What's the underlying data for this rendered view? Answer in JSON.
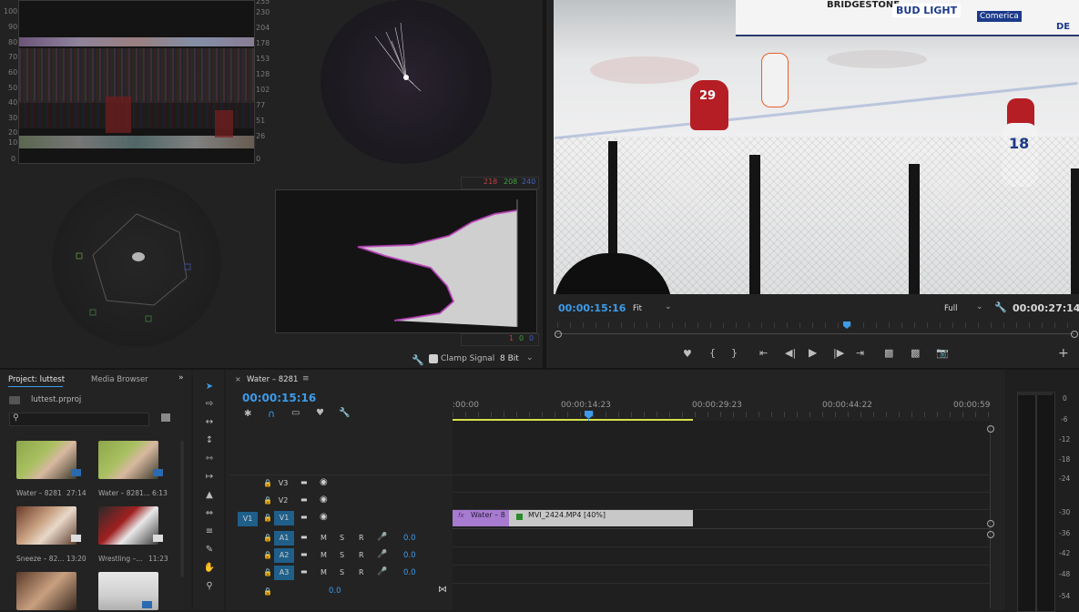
{
  "scopes": {
    "waveform_left_ticks": [
      "100",
      "90",
      "80",
      "70",
      "60",
      "50",
      "40",
      "30",
      "20",
      "10",
      "0"
    ],
    "waveform_right_ticks": [
      "255",
      "230",
      "204",
      "178",
      "153",
      "128",
      "102",
      "77",
      "51",
      "26",
      "0"
    ],
    "parade_top_values": [
      "218",
      "208",
      "240"
    ],
    "parade_bottom_values": [
      "1",
      "0",
      "0"
    ],
    "clamp_signal_label": "Clamp Signal",
    "bit_depth": "8 Bit"
  },
  "program_monitor": {
    "current_time": "00:00:15:16",
    "fit_label": "Fit",
    "quality_label": "Full",
    "duration": "00:00:27:14",
    "video_text": {
      "banner1": "BRIDGESTONE",
      "banner2": "BUD LIGHT",
      "banner3": "Comerica",
      "banner4": "DE",
      "jersey1": "29",
      "jersey2": "18"
    }
  },
  "project_panel": {
    "tab_project": "Project: luttest",
    "tab_media": "Media Browser",
    "file_name": "luttest.prproj",
    "items": [
      {
        "name": "Water – 8281",
        "duration": "27:14"
      },
      {
        "name": "Water – 8281...",
        "duration": "6:13"
      },
      {
        "name": "Sneeze – 82...",
        "duration": "13:20"
      },
      {
        "name": "Wrestling –...",
        "duration": "11:23"
      },
      {
        "name": "",
        "duration": ""
      },
      {
        "name": "",
        "duration": ""
      }
    ]
  },
  "timeline": {
    "tab_title": "Water – 8281",
    "current_time": "00:00:15:16",
    "ruler": [
      ":00:00",
      "00:00:14:23",
      "00:00:29:23",
      "00:00:44:22",
      "00:00:59"
    ],
    "tracks": {
      "v3": "V3",
      "v2": "V2",
      "v1": "V1",
      "v1_source": "V1",
      "a1": "A1",
      "a2": "A2",
      "a3": "A3",
      "m": "M",
      "s": "S",
      "r": "R",
      "vol": "0.0",
      "master_vol": "0.0"
    },
    "clip1": "Water – 8",
    "clip2": "MVI_2424.MP4 [40%]"
  },
  "meters": {
    "labels": [
      "0",
      "-6",
      "-12",
      "-18",
      "-24",
      "-30",
      "-36",
      "-42",
      "-48",
      "-54"
    ]
  }
}
